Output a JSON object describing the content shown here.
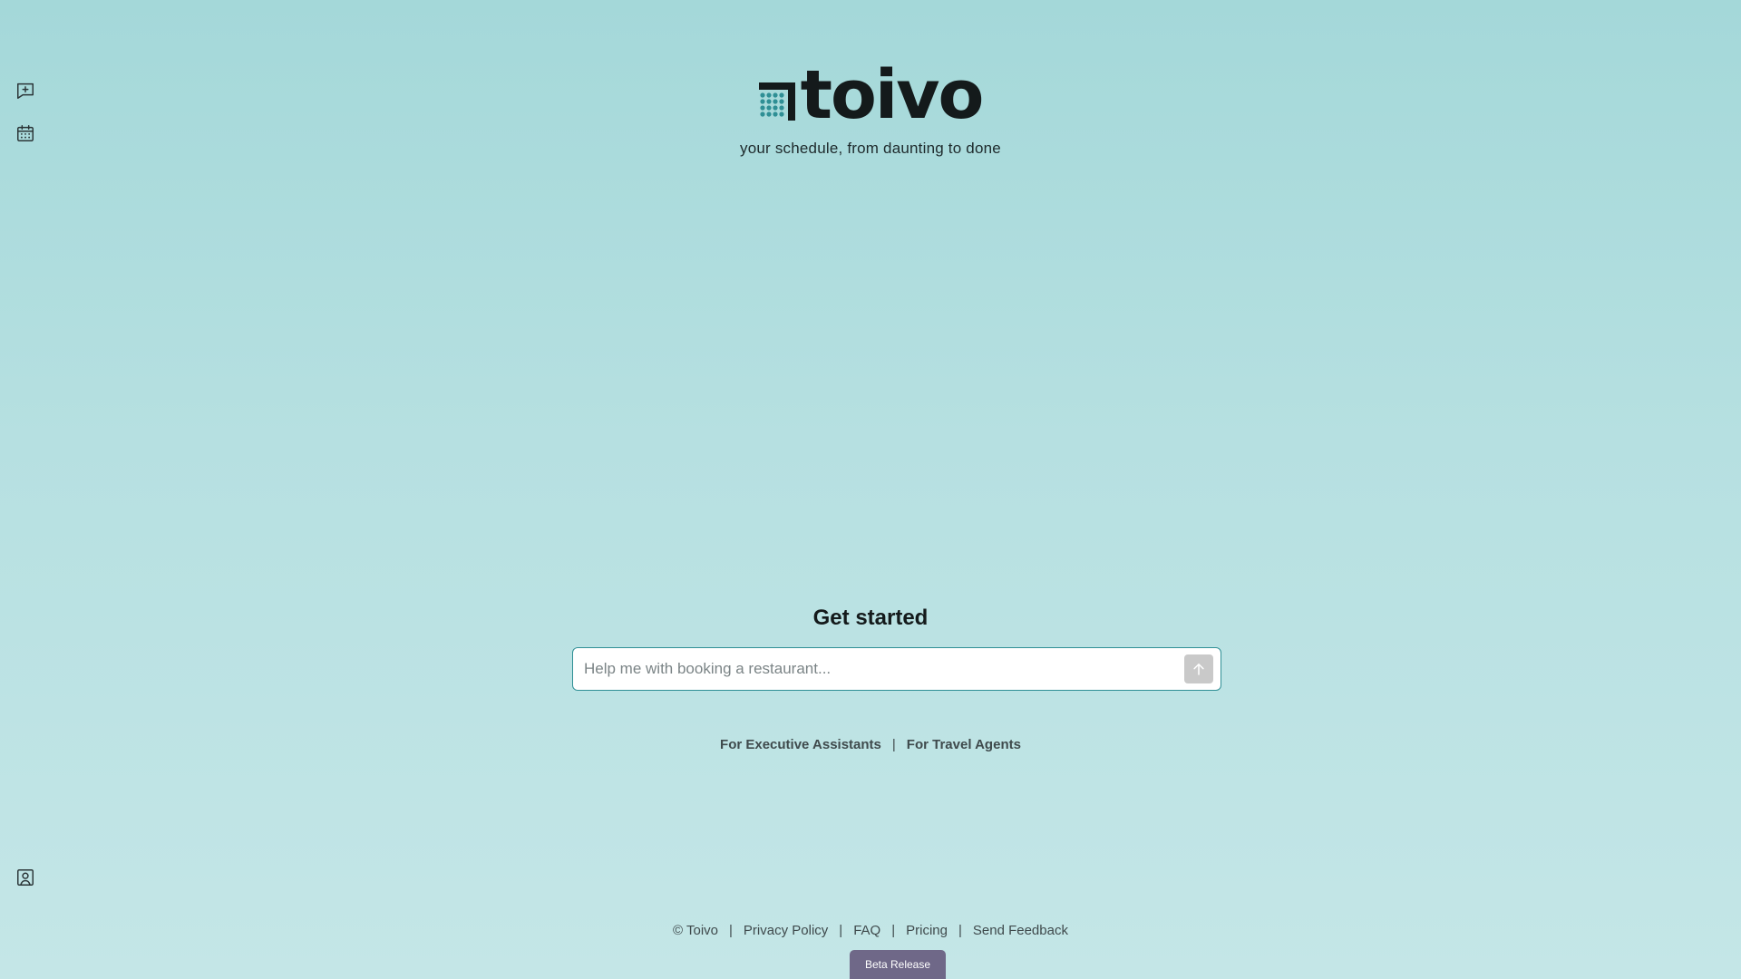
{
  "sidebar": {
    "icons": [
      "message-plus-icon",
      "calendar-icon",
      "user-profile-icon"
    ]
  },
  "brand": {
    "logo_text": "toivo",
    "tagline": "your schedule, from daunting to done",
    "accent_color": "#2f8f95"
  },
  "main": {
    "heading": "Get started",
    "input_placeholder": "Help me with booking a restaurant...",
    "input_value": ""
  },
  "audience_links": {
    "executive_assistants": "For Executive Assistants",
    "separator": "|",
    "travel_agents": "For Travel Agents"
  },
  "footer": {
    "copyright": "© Toivo",
    "separator": "|",
    "privacy": "Privacy Policy",
    "faq": "FAQ",
    "pricing": "Pricing",
    "feedback": "Send Feedback"
  },
  "badge": {
    "label": "Beta Release",
    "color": "#6f6888"
  }
}
